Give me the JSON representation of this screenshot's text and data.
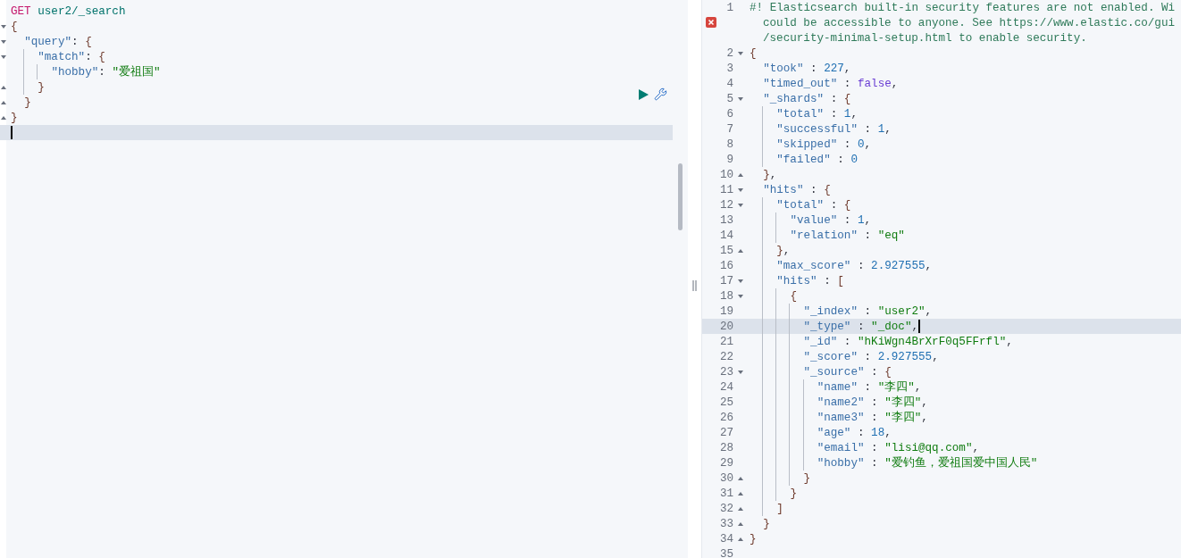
{
  "request_editor": {
    "lines": [
      {
        "tokens": [
          {
            "kind": "method",
            "text": "GET"
          },
          {
            "kind": "url",
            "text": "user2/_search"
          }
        ]
      },
      {
        "fold_start": true,
        "tokens": [
          {
            "kind": "brace",
            "text": "{"
          }
        ]
      },
      {
        "fold_start": true,
        "tokens": [
          {
            "kind": "key",
            "text": "  \"query\""
          },
          {
            "kind": "punct",
            "text": ": "
          },
          {
            "kind": "brace",
            "text": "{"
          }
        ]
      },
      {
        "fold_start": true,
        "tokens": [
          {
            "kind": "key",
            "text": "    \"match\""
          },
          {
            "kind": "punct",
            "text": ": "
          },
          {
            "kind": "brace",
            "text": "{"
          }
        ]
      },
      {
        "tokens": [
          {
            "kind": "key",
            "text": "      \"hobby\""
          },
          {
            "kind": "punct",
            "text": ": "
          },
          {
            "kind": "string",
            "text": "\"爱祖国\""
          }
        ]
      },
      {
        "fold_end": true,
        "tokens": [
          {
            "kind": "brace",
            "text": "    }"
          }
        ]
      },
      {
        "fold_end": true,
        "tokens": [
          {
            "kind": "brace",
            "text": "  }"
          }
        ]
      },
      {
        "fold_end": true,
        "tokens": [
          {
            "kind": "brace",
            "text": "}"
          }
        ]
      },
      {
        "active": true
      }
    ]
  },
  "response_editor": {
    "lines": [
      {
        "no": "1",
        "error": true,
        "tokens": [
          {
            "kind": "comment",
            "text": "#! Elasticsearch built-in security features are not enabled. Wi"
          }
        ],
        "wrapped": [
          "could be accessible to anyone. See https://www.elastic.co/gui",
          "/security-minimal-setup.html to enable security."
        ]
      },
      {
        "no": "2",
        "fold_start": true,
        "tokens": [
          {
            "kind": "brace",
            "text": "{"
          }
        ]
      },
      {
        "no": "3",
        "tokens": [
          {
            "kind": "key",
            "text": "  \"took\""
          },
          {
            "kind": "punct",
            "text": " : "
          },
          {
            "kind": "number",
            "text": "227"
          },
          {
            "kind": "punct",
            "text": ","
          }
        ]
      },
      {
        "no": "4",
        "tokens": [
          {
            "kind": "key",
            "text": "  \"timed_out\""
          },
          {
            "kind": "punct",
            "text": " : "
          },
          {
            "kind": "boolean",
            "text": "false"
          },
          {
            "kind": "punct",
            "text": ","
          }
        ]
      },
      {
        "no": "5",
        "fold_start": true,
        "tokens": [
          {
            "kind": "key",
            "text": "  \"_shards\""
          },
          {
            "kind": "punct",
            "text": " : "
          },
          {
            "kind": "brace",
            "text": "{"
          }
        ]
      },
      {
        "no": "6",
        "tokens": [
          {
            "kind": "key",
            "text": "    \"total\""
          },
          {
            "kind": "punct",
            "text": " : "
          },
          {
            "kind": "number",
            "text": "1"
          },
          {
            "kind": "punct",
            "text": ","
          }
        ]
      },
      {
        "no": "7",
        "tokens": [
          {
            "kind": "key",
            "text": "    \"successful\""
          },
          {
            "kind": "punct",
            "text": " : "
          },
          {
            "kind": "number",
            "text": "1"
          },
          {
            "kind": "punct",
            "text": ","
          }
        ]
      },
      {
        "no": "8",
        "tokens": [
          {
            "kind": "key",
            "text": "    \"skipped\""
          },
          {
            "kind": "punct",
            "text": " : "
          },
          {
            "kind": "number",
            "text": "0"
          },
          {
            "kind": "punct",
            "text": ","
          }
        ]
      },
      {
        "no": "9",
        "tokens": [
          {
            "kind": "key",
            "text": "    \"failed\""
          },
          {
            "kind": "punct",
            "text": " : "
          },
          {
            "kind": "number",
            "text": "0"
          }
        ]
      },
      {
        "no": "10",
        "fold_end": true,
        "tokens": [
          {
            "kind": "brace",
            "text": "  }"
          },
          {
            "kind": "punct",
            "text": ","
          }
        ]
      },
      {
        "no": "11",
        "fold_start": true,
        "tokens": [
          {
            "kind": "key",
            "text": "  \"hits\""
          },
          {
            "kind": "punct",
            "text": " : "
          },
          {
            "kind": "brace",
            "text": "{"
          }
        ]
      },
      {
        "no": "12",
        "fold_start": true,
        "tokens": [
          {
            "kind": "key",
            "text": "    \"total\""
          },
          {
            "kind": "punct",
            "text": " : "
          },
          {
            "kind": "brace",
            "text": "{"
          }
        ]
      },
      {
        "no": "13",
        "tokens": [
          {
            "kind": "key",
            "text": "      \"value\""
          },
          {
            "kind": "punct",
            "text": " : "
          },
          {
            "kind": "number",
            "text": "1"
          },
          {
            "kind": "punct",
            "text": ","
          }
        ]
      },
      {
        "no": "14",
        "tokens": [
          {
            "kind": "key",
            "text": "      \"relation\""
          },
          {
            "kind": "punct",
            "text": " : "
          },
          {
            "kind": "string",
            "text": "\"eq\""
          }
        ]
      },
      {
        "no": "15",
        "fold_end": true,
        "tokens": [
          {
            "kind": "brace",
            "text": "    }"
          },
          {
            "kind": "punct",
            "text": ","
          }
        ]
      },
      {
        "no": "16",
        "tokens": [
          {
            "kind": "key",
            "text": "    \"max_score\""
          },
          {
            "kind": "punct",
            "text": " : "
          },
          {
            "kind": "number",
            "text": "2.927555"
          },
          {
            "kind": "punct",
            "text": ","
          }
        ]
      },
      {
        "no": "17",
        "fold_start": true,
        "tokens": [
          {
            "kind": "key",
            "text": "    \"hits\""
          },
          {
            "kind": "punct",
            "text": " : "
          },
          {
            "kind": "brace",
            "text": "["
          }
        ]
      },
      {
        "no": "18",
        "fold_start": true,
        "tokens": [
          {
            "kind": "brace",
            "text": "      {"
          }
        ]
      },
      {
        "no": "19",
        "tokens": [
          {
            "kind": "key",
            "text": "        \"_index\""
          },
          {
            "kind": "punct",
            "text": " : "
          },
          {
            "kind": "string",
            "text": "\"user2\""
          },
          {
            "kind": "punct",
            "text": ","
          }
        ]
      },
      {
        "no": "20",
        "active": true,
        "tokens": [
          {
            "kind": "key",
            "text": "        \"_type\""
          },
          {
            "kind": "punct",
            "text": " : "
          },
          {
            "kind": "string",
            "text": "\"_doc\""
          },
          {
            "kind": "punct",
            "text": ","
          }
        ]
      },
      {
        "no": "21",
        "tokens": [
          {
            "kind": "key",
            "text": "        \"_id\""
          },
          {
            "kind": "punct",
            "text": " : "
          },
          {
            "kind": "string",
            "text": "\"hKiWgn4BrXrF0q5FFrfl\""
          },
          {
            "kind": "punct",
            "text": ","
          }
        ]
      },
      {
        "no": "22",
        "tokens": [
          {
            "kind": "key",
            "text": "        \"_score\""
          },
          {
            "kind": "punct",
            "text": " : "
          },
          {
            "kind": "number",
            "text": "2.927555"
          },
          {
            "kind": "punct",
            "text": ","
          }
        ]
      },
      {
        "no": "23",
        "fold_start": true,
        "tokens": [
          {
            "kind": "key",
            "text": "        \"_source\""
          },
          {
            "kind": "punct",
            "text": " : "
          },
          {
            "kind": "brace",
            "text": "{"
          }
        ]
      },
      {
        "no": "24",
        "tokens": [
          {
            "kind": "key",
            "text": "          \"name\""
          },
          {
            "kind": "punct",
            "text": " : "
          },
          {
            "kind": "string",
            "text": "\"李四\""
          },
          {
            "kind": "punct",
            "text": ","
          }
        ]
      },
      {
        "no": "25",
        "tokens": [
          {
            "kind": "key",
            "text": "          \"name2\""
          },
          {
            "kind": "punct",
            "text": " : "
          },
          {
            "kind": "string",
            "text": "\"李四\""
          },
          {
            "kind": "punct",
            "text": ","
          }
        ]
      },
      {
        "no": "26",
        "tokens": [
          {
            "kind": "key",
            "text": "          \"name3\""
          },
          {
            "kind": "punct",
            "text": " : "
          },
          {
            "kind": "string",
            "text": "\"李四\""
          },
          {
            "kind": "punct",
            "text": ","
          }
        ]
      },
      {
        "no": "27",
        "tokens": [
          {
            "kind": "key",
            "text": "          \"age\""
          },
          {
            "kind": "punct",
            "text": " : "
          },
          {
            "kind": "number",
            "text": "18"
          },
          {
            "kind": "punct",
            "text": ","
          }
        ]
      },
      {
        "no": "28",
        "tokens": [
          {
            "kind": "key",
            "text": "          \"email\""
          },
          {
            "kind": "punct",
            "text": " : "
          },
          {
            "kind": "string",
            "text": "\"lisi@qq.com\""
          },
          {
            "kind": "punct",
            "text": ","
          }
        ]
      },
      {
        "no": "29",
        "tokens": [
          {
            "kind": "key",
            "text": "          \"hobby\""
          },
          {
            "kind": "punct",
            "text": " : "
          },
          {
            "kind": "string",
            "text": "\"爱钓鱼，爱祖国爱中国人民\""
          }
        ]
      },
      {
        "no": "30",
        "fold_end": true,
        "tokens": [
          {
            "kind": "brace",
            "text": "        }"
          }
        ]
      },
      {
        "no": "31",
        "fold_end": true,
        "tokens": [
          {
            "kind": "brace",
            "text": "      }"
          }
        ]
      },
      {
        "no": "32",
        "fold_end": true,
        "tokens": [
          {
            "kind": "brace",
            "text": "    ]"
          }
        ]
      },
      {
        "no": "33",
        "fold_end": true,
        "tokens": [
          {
            "kind": "brace",
            "text": "  }"
          }
        ]
      },
      {
        "no": "34",
        "fold_end": true,
        "tokens": [
          {
            "kind": "brace",
            "text": "}"
          }
        ]
      },
      {
        "no": "35"
      }
    ]
  }
}
